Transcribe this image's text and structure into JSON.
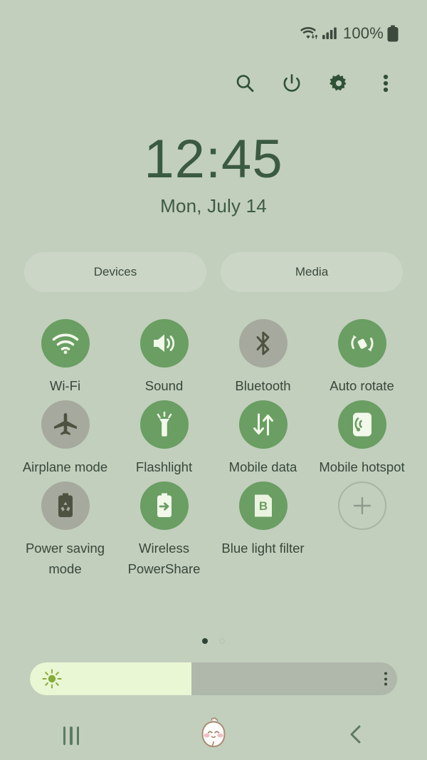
{
  "status_bar": {
    "wifi_icon": "wifi-data-icon",
    "signal_icon": "cellular-signal-icon",
    "battery_percent": "100%",
    "battery_icon": "battery-full-icon"
  },
  "toolbar": {
    "buttons": [
      {
        "name": "search-icon",
        "label": "Search"
      },
      {
        "name": "power-icon",
        "label": "Power"
      },
      {
        "name": "gear-icon",
        "label": "Settings"
      },
      {
        "name": "overflow-menu-icon",
        "label": "More options"
      }
    ]
  },
  "clock": {
    "time": "12:45",
    "date": "Mon, July 14"
  },
  "pills": [
    {
      "label": "Devices"
    },
    {
      "label": "Media"
    }
  ],
  "tiles": [
    {
      "label": "Wi-Fi",
      "icon": "wifi-icon",
      "state": "on"
    },
    {
      "label": "Sound",
      "icon": "sound-icon",
      "state": "on"
    },
    {
      "label": "Bluetooth",
      "icon": "bluetooth-icon",
      "state": "off"
    },
    {
      "label": "Auto rotate",
      "icon": "auto-rotate-icon",
      "state": "on"
    },
    {
      "label": "Airplane mode",
      "icon": "airplane-icon",
      "state": "off"
    },
    {
      "label": "Flashlight",
      "icon": "flashlight-icon",
      "state": "on"
    },
    {
      "label": "Mobile data",
      "icon": "mobile-data-icon",
      "state": "on"
    },
    {
      "label": "Mobile hotspot",
      "icon": "mobile-hotspot-icon",
      "state": "on"
    },
    {
      "label": "Power saving mode",
      "icon": "power-saving-icon",
      "state": "off"
    },
    {
      "label": "Wireless PowerShare",
      "icon": "power-share-icon",
      "state": "on"
    },
    {
      "label": "Blue light filter",
      "icon": "blue-light-filter-icon",
      "state": "on"
    },
    {
      "label": "",
      "icon": "add-tile-icon",
      "state": "add"
    }
  ],
  "pagination": {
    "pages": 2,
    "active_page": 1
  },
  "brightness": {
    "value_percent": 44,
    "sun_icon": "brightness-sun-icon",
    "menu_icon": "brightness-options-icon"
  },
  "nav_bar": {
    "recents_label": "Recents",
    "home_label": "Home",
    "back_label": "Back"
  },
  "colors": {
    "background": "#c2cfbd",
    "toggle_on": "#6a9e63",
    "toggle_off": "#a6aa9e",
    "accent_text": "#3a5a41",
    "slider_fill": "#eaf7d4",
    "slider_track": "#b0b8ab"
  }
}
